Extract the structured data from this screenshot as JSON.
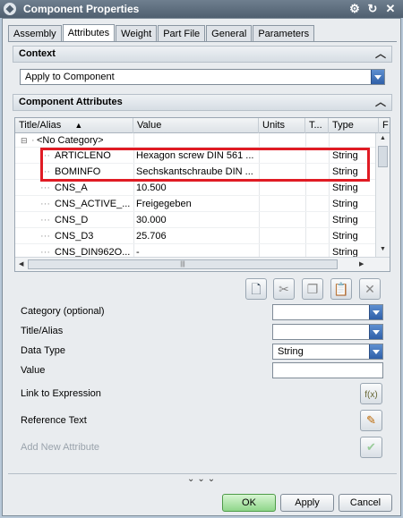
{
  "window": {
    "title": "Component Properties"
  },
  "titlebar_buttons": [
    "settings-icon",
    "refresh-icon",
    "close-icon"
  ],
  "tabs": [
    {
      "label": "Assembly",
      "active": false
    },
    {
      "label": "Attributes",
      "active": true
    },
    {
      "label": "Weight",
      "active": false
    },
    {
      "label": "Part File",
      "active": false
    },
    {
      "label": "General",
      "active": false
    },
    {
      "label": "Parameters",
      "active": false
    }
  ],
  "context": {
    "header": "Context",
    "dropdown_value": "Apply to Component"
  },
  "attributes": {
    "header": "Component Attributes",
    "columns": {
      "title": "Title/Alias",
      "value": "Value",
      "units": "Units",
      "t": "T...",
      "type": "Type",
      "extra": "F"
    },
    "category_label": "<No Category>",
    "rows": [
      {
        "title": "ARTICLENO",
        "value": "Hexagon screw DIN 561 ...",
        "type": "String"
      },
      {
        "title": "BOMINFO",
        "value": "Sechskantschraube DIN ...",
        "type": "String"
      },
      {
        "title": "CNS_A",
        "value": "10.500",
        "type": "String"
      },
      {
        "title": "CNS_ACTIVE_...",
        "value": "Freigegeben",
        "type": "String"
      },
      {
        "title": "CNS_D",
        "value": "30.000",
        "type": "String"
      },
      {
        "title": "CNS_D3",
        "value": "25.706",
        "type": "String"
      },
      {
        "title": "CNS_DIN962O...",
        "value": "-",
        "type": "String"
      }
    ]
  },
  "toolbar_icons": [
    "new-attribute-icon",
    "cut-icon",
    "copy-icon",
    "paste-icon",
    "delete-icon"
  ],
  "form": {
    "category_label": "Category (optional)",
    "category_value": "",
    "title_label": "Title/Alias",
    "title_value": "",
    "datatype_label": "Data Type",
    "datatype_value": "String",
    "value_label": "Value",
    "value_value": "",
    "link_label": "Link to Expression",
    "reference_label": "Reference Text",
    "add_label": "Add New Attribute"
  },
  "buttons": {
    "ok": "OK",
    "apply": "Apply",
    "cancel": "Cancel"
  },
  "colors": {
    "titlebar": "#4f5f6f",
    "highlight": "#e01b24",
    "ok_button": "#8fd68a",
    "dropdown_arrow": "#2f5fa8"
  }
}
